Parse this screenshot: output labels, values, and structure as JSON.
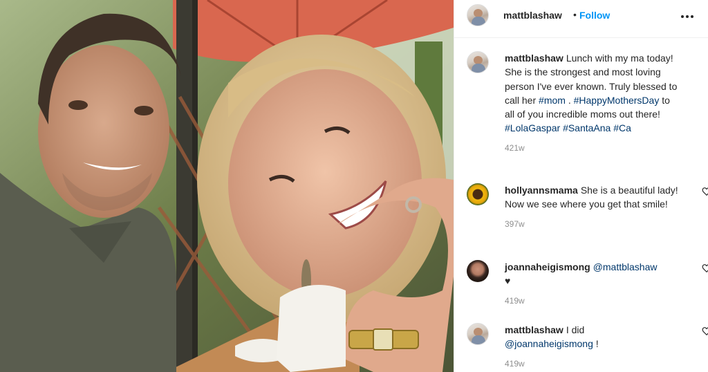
{
  "post": {
    "author": "mattblashaw",
    "separator": "•",
    "follow_label": "Follow",
    "caption": {
      "username": "mattblashaw",
      "text_1": "Lunch with my ma today! She is the strongest and most loving person I've ever known. Truly blessed to call her ",
      "tag_mom": "#mom",
      "text_2": " . ",
      "tag_mothers_day": "#HappyMothersDay",
      "text_3": " to all of you incredible moms out there! ",
      "tag_lola": "#LolaGaspar",
      "tag_santaana": "#SantaAna",
      "tag_ca": "#Ca",
      "time": "421w"
    }
  },
  "comments": [
    {
      "username": "hollyannsmama",
      "text": "She is a beautiful lady! Now we see where you get that smile!",
      "time": "397w"
    },
    {
      "username": "joannaheigismong",
      "mention": "@mattblashaw",
      "heart": "♥",
      "time": "419w"
    },
    {
      "username": "mattblashaw",
      "text": "I did",
      "mention": "@joannaheigismong",
      "suffix": " !",
      "time": "419w"
    }
  ],
  "colors": {
    "link": "#0095f6",
    "hashtag": "#00376b",
    "meta": "#8e8e8e"
  },
  "icons": [
    "more-options-icon",
    "heart-outline-icon"
  ]
}
